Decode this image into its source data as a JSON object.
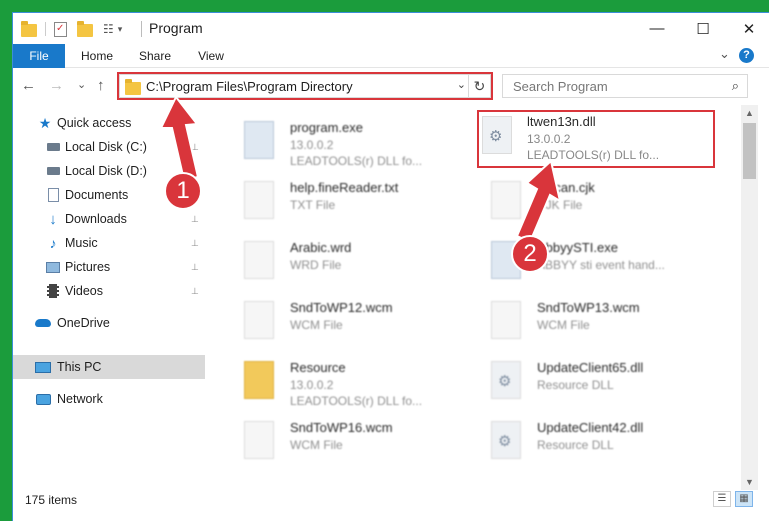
{
  "window": {
    "title": "Program",
    "controls": {
      "minimize": "—",
      "maximize": "☐",
      "close": "✕"
    }
  },
  "ribbon": {
    "tabs": [
      "File",
      "Home",
      "Share",
      "View"
    ],
    "expand_glyph": "⌄",
    "help_glyph": "?"
  },
  "nav": {
    "back": "←",
    "forward": "→",
    "recent": "⌄",
    "up": "↑",
    "address": "C:\\Program Files\\Program Directory",
    "address_dropdown": "⌄",
    "refresh": "↻",
    "search_placeholder": "Search Program",
    "search_icon": "⌕"
  },
  "sidebar": {
    "items": [
      {
        "label": "Quick access",
        "icon": "star-icon"
      },
      {
        "label": "Local Disk (C:)",
        "icon": "drive-icon"
      },
      {
        "label": "Local Disk (D:)",
        "icon": "drive-icon"
      },
      {
        "label": "Documents",
        "icon": "document-icon"
      },
      {
        "label": "Downloads",
        "icon": "download-icon"
      },
      {
        "label": "Music",
        "icon": "music-icon"
      },
      {
        "label": "Pictures",
        "icon": "picture-icon"
      },
      {
        "label": "Videos",
        "icon": "video-icon"
      },
      {
        "label": "OneDrive",
        "icon": "cloud-icon"
      },
      {
        "label": "This PC",
        "icon": "computer-icon"
      },
      {
        "label": "Network",
        "icon": "network-icon"
      }
    ],
    "pin_glyph": "📌"
  },
  "files": [
    {
      "name": "program.exe",
      "line1": "13.0.0.2",
      "line2": "LEADTOOLS(r) DLL fo...",
      "icon": "exe"
    },
    {
      "name": "ltwen13n.dll",
      "line1": "13.0.0.2",
      "line2": "LEADTOOLS(r) DLL fo...",
      "icon": "gear"
    },
    {
      "name": "help.fineReader.txt",
      "line1": "TXT File",
      "line2": "",
      "icon": "doc"
    },
    {
      "name": "lo_can.cjk",
      "line1": "CJK File",
      "line2": "",
      "icon": "doc"
    },
    {
      "name": "Arabic.wrd",
      "line1": "WRD File",
      "line2": "",
      "icon": "doc"
    },
    {
      "name": "AbbyySTI.exe",
      "line1": "ABBYY sti event hand...",
      "line2": "",
      "icon": "exe"
    },
    {
      "name": "SndToWP12.wcm",
      "line1": "WCM File",
      "line2": "",
      "icon": "doc"
    },
    {
      "name": "SndToWP13.wcm",
      "line1": "WCM File",
      "line2": "",
      "icon": "doc"
    },
    {
      "name": "Resource",
      "line1": "13.0.0.2",
      "line2": "LEADTOOLS(r) DLL fo...",
      "icon": "folder"
    },
    {
      "name": "UpdateClient65.dll",
      "line1": "Resource DLL",
      "line2": "",
      "icon": "gear"
    },
    {
      "name": "SndToWP16.wcm",
      "line1": "WCM File",
      "line2": "",
      "icon": "doc"
    },
    {
      "name": "UpdateClient42.dll",
      "line1": "Resource DLL",
      "line2": "",
      "icon": "gear"
    }
  ],
  "status": {
    "item_count": "175 items"
  },
  "annotations": {
    "marker1": "1",
    "marker2": "2"
  }
}
